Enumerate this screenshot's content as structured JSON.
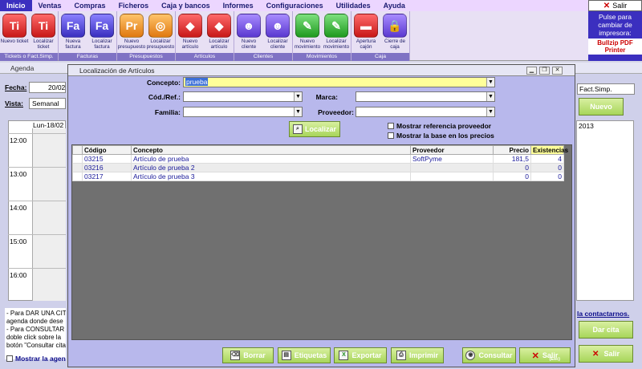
{
  "menu": [
    "Inicio",
    "Ventas",
    "Compras",
    "Ficheros",
    "Caja y bancos",
    "Informes",
    "Configuraciones",
    "Utilidades",
    "Ayuda"
  ],
  "exit_label": "Salir",
  "ribbon": [
    {
      "title": "Tickets o Fact.Simp.",
      "buttons": [
        {
          "glyph": "Ti",
          "label": "Nuevo ticket",
          "color": "red"
        },
        {
          "glyph": "Ti",
          "label": "Localizar ticket",
          "color": "red"
        }
      ]
    },
    {
      "title": "Facturas",
      "buttons": [
        {
          "glyph": "Fa",
          "label": "Nueva factura",
          "color": "blue"
        },
        {
          "glyph": "Fa",
          "label": "Localizar factura",
          "color": "blue"
        }
      ]
    },
    {
      "title": "Presupuestos",
      "buttons": [
        {
          "glyph": "Pr",
          "label": "Nuevo presupuesto",
          "color": "orange"
        },
        {
          "glyph": "◎",
          "label": "Localizar presupuesto",
          "color": "orange"
        }
      ]
    },
    {
      "title": "Artículos",
      "buttons": [
        {
          "glyph": "◆",
          "label": "Nuevo artículo",
          "color": "red"
        },
        {
          "glyph": "◆",
          "label": "Localizar artículo",
          "color": "red"
        }
      ]
    },
    {
      "title": "Clientes",
      "buttons": [
        {
          "glyph": "☻",
          "label": "Nuevo cliente",
          "color": "pur"
        },
        {
          "glyph": "☻",
          "label": "Localizar cliente",
          "color": "pur"
        }
      ]
    },
    {
      "title": "Movimientos",
      "buttons": [
        {
          "glyph": "✎",
          "label": "Nuevo movimiento",
          "color": "grn"
        },
        {
          "glyph": "✎",
          "label": "Localizar movimiento",
          "color": "grn"
        }
      ]
    },
    {
      "title": "Caja",
      "buttons": [
        {
          "glyph": "▬",
          "label": "Apertura cajón",
          "color": "red"
        },
        {
          "glyph": "🔒",
          "label": "Cierre de caja",
          "color": "pur"
        }
      ]
    }
  ],
  "printer": {
    "prompt": "Pulse para cambiar de impresora:",
    "name": "Bullzip PDF Printer"
  },
  "agenda": {
    "title": "Agenda",
    "fecha_label": "Fecha:",
    "fecha_value": "20/02",
    "vista_label": "Vista:",
    "vista_value": "Semanal",
    "day_header": "Lun-18/02",
    "times": [
      "12:00",
      "13:00",
      "14:00",
      "15:00",
      "16:00"
    ],
    "info_lines": [
      "- Para DAR UNA CIT",
      "agenda donde dese",
      "- Para CONSULTAR",
      "doble click sobre la",
      "botón \"Consultar cita"
    ],
    "show_label": "Mostrar la agen",
    "right_combo": "Fact.Simp.",
    "nuevo_label": "Nuevo",
    "right_date": "2013",
    "contact_link": "la contactarnos.",
    "dar_cita_label": "Dar cita",
    "salir_label": "Salir"
  },
  "dialog": {
    "title": "Localización de Artículos",
    "concepto_label": "Concepto:",
    "concepto_value": "prueba",
    "codref_label": "Cód./Ref.:",
    "marca_label": "Marca:",
    "familia_label": "Familia:",
    "proveedor_label": "Proveedor:",
    "localizar_label": "Localizar",
    "chk_ref": "Mostrar referencia proveedor",
    "chk_base": "Mostrar la base en los precios",
    "columns": [
      "Código",
      "Concepto",
      "Proveedor",
      "Precio",
      "Existencias"
    ],
    "rows": [
      [
        "03215",
        "Artículo de prueba",
        "SoftPyme",
        "181,5",
        "4"
      ],
      [
        "03216",
        "Artículo de prueba 2",
        "",
        "0",
        "0"
      ],
      [
        "03217",
        "Artículo de prueba 3",
        "",
        "0",
        "0"
      ]
    ],
    "buttons": {
      "borrar": "Borrar",
      "etiquetas": "Etiquetas",
      "exportar": "Exportar",
      "imprimir": "Imprimir",
      "consultar": "Consultar",
      "salir": "Salir",
      "salir_sub": "(Esc)"
    }
  }
}
